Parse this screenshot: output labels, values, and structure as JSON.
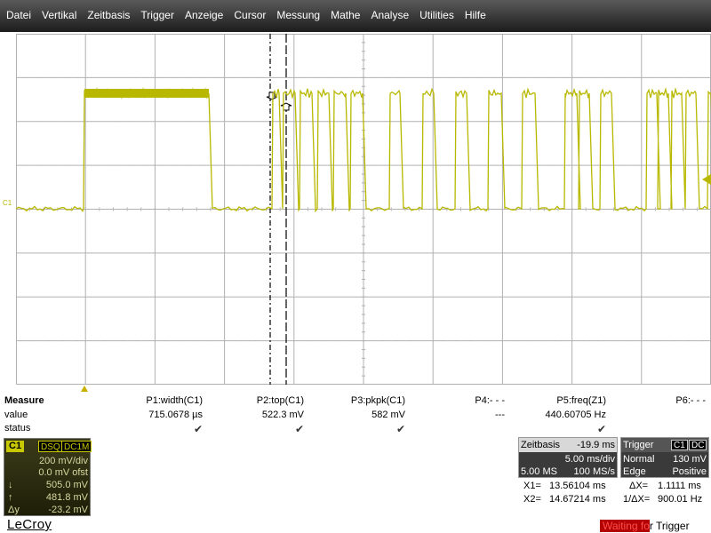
{
  "menu": [
    "Datei",
    "Vertikal",
    "Zeitbasis",
    "Trigger",
    "Anzeige",
    "Cursor",
    "Messung",
    "Mathe",
    "Analyse",
    "Utilities",
    "Hilfe"
  ],
  "channel_marker": "C1",
  "measure": {
    "title": "Measure",
    "value_label": "value",
    "status_label": "status",
    "params": [
      {
        "name": "P1:width(C1)",
        "value": "715.0678 µs",
        "status": "✔"
      },
      {
        "name": "P2:top(C1)",
        "value": "522.3 mV",
        "status": "✔"
      },
      {
        "name": "P3:pkpk(C1)",
        "value": "582 mV",
        "status": "✔"
      },
      {
        "name": "P4:- - -",
        "value": "---",
        "status": ""
      },
      {
        "name": "P5:freq(Z1)",
        "value": "440.60705 Hz",
        "status": "✔"
      },
      {
        "name": "P6:- - -",
        "value": "",
        "status": ""
      }
    ]
  },
  "c1": {
    "tag": "C1",
    "tag_dsq": "DSQ",
    "tag_coupling": "DC1M",
    "vdiv": "200 mV/div",
    "offset": "0.0 mV ofst",
    "cursor_down_sym": "↓",
    "cursor_down": "505.0 mV",
    "cursor_up_sym": "↑",
    "cursor_up": "481.8 mV",
    "delta_sym": "Δy",
    "delta": "-23.2 mV"
  },
  "timebase": {
    "label": "Zeitbasis",
    "delay": "-19.9 ms",
    "tdiv": "5.00 ms/div",
    "samples": "5.00 MS",
    "rate": "100 MS/s"
  },
  "trigger": {
    "label": "Trigger",
    "source": "C1",
    "coupling": "DC",
    "mode": "Normal",
    "level": "130 mV",
    "type": "Edge",
    "slope": "Positive"
  },
  "cursors": {
    "x1_label": "X1=",
    "x1": "13.56104 ms",
    "dx_label": "ΔX=",
    "dx": "1.1111 ms",
    "x2_label": "X2=",
    "x2": "14.67214 ms",
    "inv_dx_label": "1/ΔX=",
    "inv_dx": "900.01 Hz"
  },
  "logo": "LeCroy",
  "status": {
    "highlight": "Waiting fo",
    "rest": "r Trigger"
  },
  "colors": {
    "trace": "#b8b800",
    "grid": "#b0b0b0",
    "menu_bg": "#2a2a2a"
  }
}
